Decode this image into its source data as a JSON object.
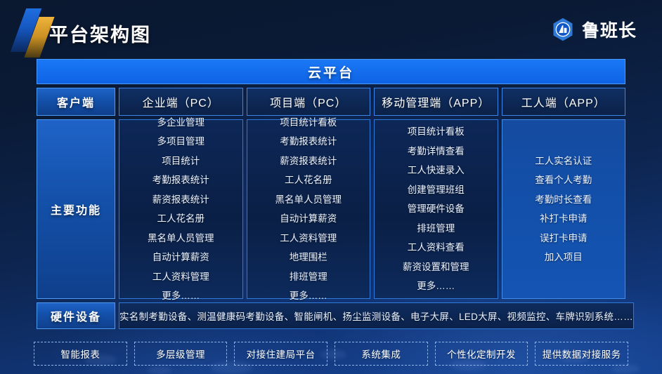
{
  "header": {
    "title": "平台架构图",
    "logo_text": "鲁班长"
  },
  "cloud_bar": {
    "label": "云平台"
  },
  "row_labels": {
    "client": "客户端",
    "main_functions": "主要功能",
    "hardware": "硬件设备"
  },
  "columns": [
    {
      "head": "企业端（PC）",
      "features": [
        "多企业管理",
        "多项目管理",
        "项目统计",
        "考勤报表统计",
        "薪资报表统计",
        "工人花名册",
        "黑名单人员管理",
        "自动计算薪资",
        "工人资料管理",
        "更多……"
      ]
    },
    {
      "head": "项目端（PC）",
      "features": [
        "项目统计看板",
        "考勤报表统计",
        "薪资报表统计",
        "工人花名册",
        "黑名单人员管理",
        "自动计算薪资",
        "工人资料管理",
        "地理围栏",
        "排班管理",
        "更多……"
      ]
    },
    {
      "head": "移动管理端（APP）",
      "features": [
        "项目统计看板",
        "考勤详情查看",
        "工人快速录入",
        "创建管理班组",
        "管理硬件设备",
        "排班管理",
        "工人资料查看",
        "薪资设置和管理",
        "更多……"
      ]
    },
    {
      "head": "工人端（APP）",
      "features": [
        "工人实名认证",
        "查看个人考勤",
        "考勤时长查看",
        "补打卡申请",
        "误打卡申请",
        "加入项目"
      ]
    }
  ],
  "hardware_list": "实名制考勤设备、测温健康码考勤设备、智能闸机、扬尘监测设备、电子大屏、LED大屏、视频监控、车牌识别系统……",
  "chips": [
    "智能报表",
    "多层级管理",
    "对接住建局平台",
    "系统集成",
    "个性化定制开发",
    "提供数据对接服务"
  ],
  "colors": {
    "accent_blue": "#1a78f5",
    "border_blue": "#2f7ad8",
    "label_blue": "#1f63c8",
    "background_navy": "#0a1830",
    "gold": "#f0b43c"
  }
}
